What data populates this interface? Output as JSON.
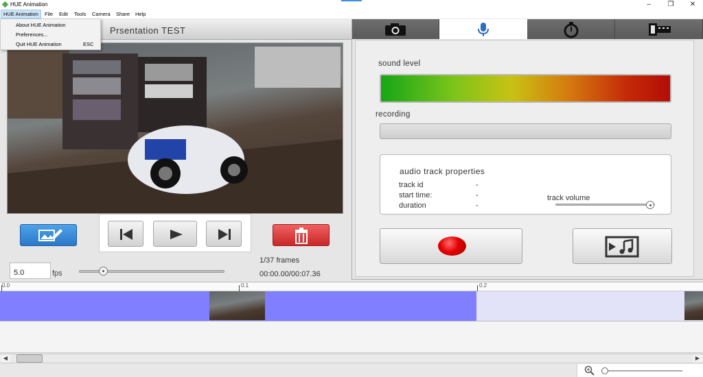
{
  "window": {
    "title": "HUE Animation",
    "accent_color": "#3b8fd9",
    "controls": [
      "minimize-icon",
      "restore-icon",
      "close-icon"
    ]
  },
  "menubar": {
    "items": [
      "HUE Animation",
      "File",
      "Edit",
      "Tools",
      "Camera",
      "Share",
      "Help"
    ],
    "active": "HUE Animation"
  },
  "app_menu": {
    "items": [
      {
        "label": "About HUE Animation",
        "shortcut": ""
      },
      {
        "label": "Preferences...",
        "shortcut": ""
      },
      {
        "label": "Quit HUE Animation",
        "shortcut": "ESC"
      }
    ]
  },
  "project": {
    "title": "Prsentation TEST"
  },
  "preview": {
    "icon": "video-frame-preview",
    "description_icon": "camera-feed"
  },
  "controls": {
    "edit_button_icon": "edit-frame-icon",
    "first_frame_icon": "skip-to-start-icon",
    "play_icon": "play-icon",
    "last_frame_icon": "skip-to-end-icon",
    "delete_icon": "trash-icon",
    "fps_value": "5.0",
    "fps_label": "fps",
    "fps_slider_level": 0.15,
    "frames_label": "1/37 frames",
    "time_label": "00:00.00/00:07.36"
  },
  "tabs": [
    {
      "icon": "camera-icon",
      "active": false
    },
    {
      "icon": "microphone-icon",
      "active": true
    },
    {
      "icon": "stopwatch-icon",
      "active": false
    },
    {
      "icon": "film-strip-icon",
      "active": false
    }
  ],
  "audio": {
    "sound_level_label": "sound level",
    "recording_label": "recording",
    "properties_title": "audio track properties",
    "track_id_label": "track id",
    "track_id_value": "-",
    "start_time_label": "start time:",
    "start_time_value": "-",
    "duration_label": "duration",
    "duration_value": "-",
    "track_volume_label": "track volume",
    "track_volume_level": 1.0,
    "record_icon": "record-icon",
    "import_icon": "import-audio-icon",
    "level_colors": [
      "#17a617",
      "#c8c214",
      "#b30d05"
    ]
  },
  "timeline": {
    "ticks": [
      "0.0",
      "0.1",
      "0.2"
    ],
    "clip_color": "#7f7fff",
    "clip_light_color": "#e2e2f8"
  },
  "zoom": {
    "icon": "zoom-in-icon",
    "level": 0.0
  }
}
